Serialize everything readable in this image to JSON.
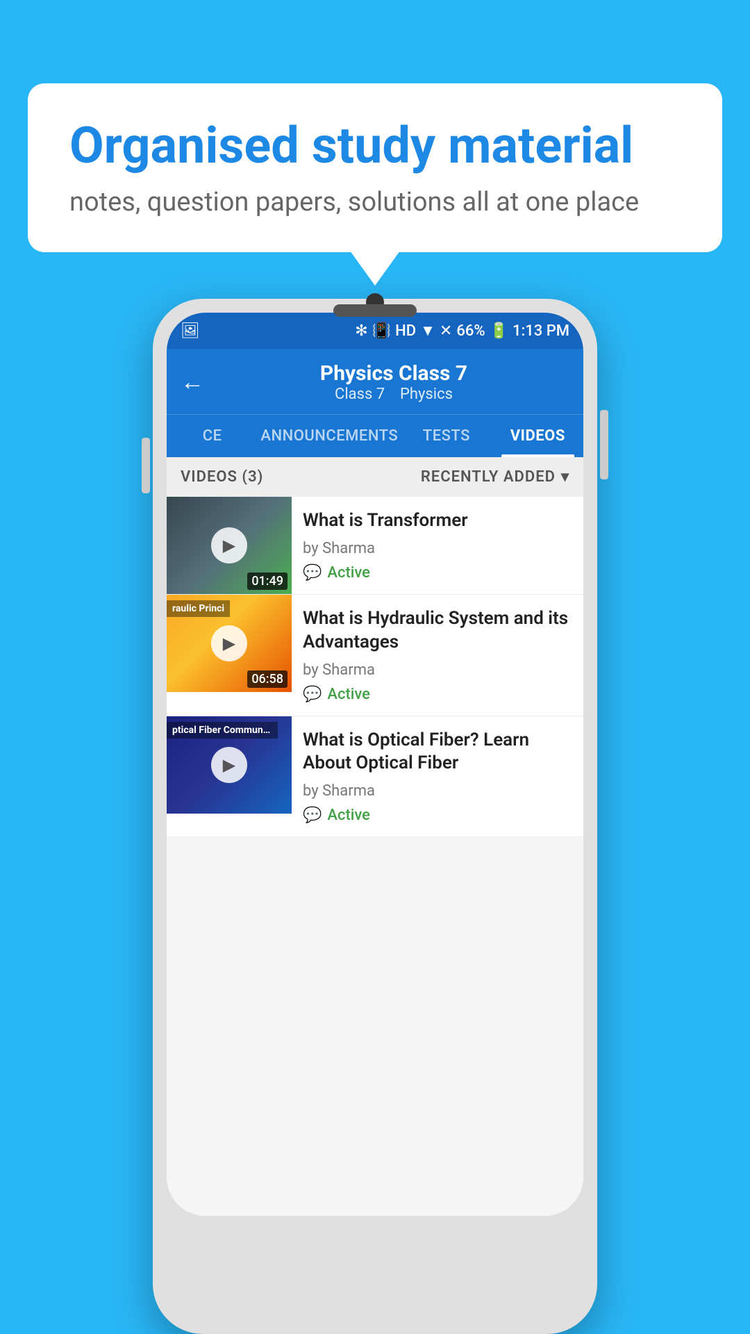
{
  "background": {
    "color": "#29b6f6"
  },
  "speech_bubble": {
    "title": "Organised study material",
    "subtitle": "notes, question papers, solutions all at one place"
  },
  "phone": {
    "status_bar": {
      "time": "1:13 PM",
      "battery": "66%",
      "signal": "HD"
    },
    "app_bar": {
      "title": "Physics Class 7",
      "subtitle_class": "Class 7",
      "subtitle_subject": "Physics",
      "back_label": "←"
    },
    "tabs": [
      {
        "label": "CE",
        "active": false
      },
      {
        "label": "ANNOUNCEMENTS",
        "active": false
      },
      {
        "label": "TESTS",
        "active": false
      },
      {
        "label": "VIDEOS",
        "active": true
      }
    ],
    "videos_header": {
      "count_label": "VIDEOS (3)",
      "sort_label": "RECENTLY ADDED"
    },
    "videos": [
      {
        "title": "What is  Transformer",
        "author": "by Sharma",
        "status": "Active",
        "duration": "01:49",
        "thumb_type": "transformer"
      },
      {
        "title": "What is Hydraulic System and its Advantages",
        "author": "by Sharma",
        "status": "Active",
        "duration": "06:58",
        "thumb_type": "hydraulic",
        "thumb_overlay": "raulic Princi"
      },
      {
        "title": "What is Optical Fiber? Learn About Optical Fiber",
        "author": "by Sharma",
        "status": "Active",
        "duration": "",
        "thumb_type": "optical",
        "thumb_overlay": "ptical Fiber Communicati"
      }
    ]
  }
}
